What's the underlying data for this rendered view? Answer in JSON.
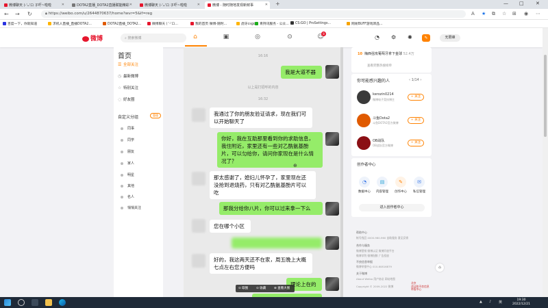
{
  "browser": {
    "tabs": [
      {
        "title": "微博聊天 (-'ᴗ'ロ 子吓~啦啦"
      },
      {
        "title": "DOTA2直播_DOTA2直播赋能精彩"
      },
      {
        "title": "微博聊天 (-'ᴗ'ロ 子吓~啦啦"
      },
      {
        "title": "微博 - 随时随地发现新鲜事"
      }
    ],
    "new_tab": "+",
    "window_controls": {
      "minimize": "—",
      "maximize": "□",
      "close": "✕"
    },
    "url": "https://weibo.com/u/2644870637/home?wvr=5&lf=reg",
    "bookmarks": [
      "百度一下，你就知道",
      "求机人直播_直播DOTA2...",
      "DOTA2直播_DOTA2...",
      "微博聊天 ( '-'ロ...",
      "我的首页 微博-随时...",
      "虎牙csgo",
      "青持讯服务 - 公众...",
      "CS:GO | ProSettings...",
      "网易BUFF游戏饰品..."
    ]
  },
  "weibo": {
    "logo": "微博",
    "search_placeholder": "搜索微博",
    "notification_count": "8",
    "user_button": "无限峰",
    "sidebar": {
      "title": "首页",
      "items": [
        {
          "label": "全部关注",
          "icon": "list-icon",
          "active": true
        },
        {
          "label": "最新微博",
          "icon": "clock-icon",
          "active": false
        },
        {
          "label": "特别关注",
          "icon": "star-icon",
          "active": false
        },
        {
          "label": "好友圈",
          "icon": "friends-icon",
          "active": false
        }
      ],
      "group_title": "自定义分组",
      "manage_label": "管理",
      "groups": [
        "同事",
        "同学",
        "朋友",
        "家人",
        "明星",
        "其他",
        "名人",
        "悄悄关注"
      ]
    },
    "chat": {
      "timestamps": [
        "16:16",
        "16:32"
      ],
      "system_notice": "以上是打招呼的内容",
      "messages": [
        {
          "from": "me",
          "text": "我是大道不器"
        },
        {
          "from": "them",
          "text": "我通过了你的朋友验证请求，现在我们可\n以开始聊天了"
        },
        {
          "from": "me",
          "text": "你好，我在互助那里看到你的求助信息，\n我住附近，家里还有一些对乙酰氨基酚\n片，可以匀给你，请问你家现在是什么情\n况了？"
        },
        {
          "from": "them",
          "text": "那太感谢了，媳妇儿怀孕了，家里现在还\n没抢到退烧药，只有对乙酰氨基酚片可以\n吃"
        },
        {
          "from": "me",
          "text": "那我分给你八片，你可以过来拿一下么"
        },
        {
          "from": "them",
          "text": "您在哪个小区"
        },
        {
          "from": "me",
          "text": ""
        },
        {
          "from": "them",
          "text": "好的，我这两天还不在家，周五晚上大概\n七点左右您方便吗"
        },
        {
          "from": "me",
          "text": "理论上在的"
        }
      ],
      "media_toolbar": [
        "⊙ 取图",
        "⊙ 收藏",
        "⊕ 查看大图"
      ]
    },
    "right": {
      "hot_rank": "10",
      "hot_title": "梅西强攻葡萄牙拿下金球",
      "hot_count": "52.4万",
      "refresh_label": "查看完整热搜榜单",
      "rec_title": "你可能感兴趣的人",
      "rec_pager": "1/14",
      "recommendations": [
        {
          "name": "kerozin0214",
          "desc": "微博电子竞技博主",
          "follow": "+ 关注"
        },
        {
          "name": "斗鱼Dota2",
          "desc": "斗鱼DOTA2官方微博",
          "follow": "+ 关注"
        },
        {
          "name": "OB战队",
          "desc": "OB战队官方微博",
          "follow": "+ 关注"
        }
      ],
      "creator_title": "创作者中心",
      "creator_tools": [
        {
          "label": "数据中心",
          "icon": "chart-icon"
        },
        {
          "label": "内容管理",
          "icon": "doc-icon"
        },
        {
          "label": "创作中心",
          "icon": "pen-icon"
        },
        {
          "label": "私信管理",
          "icon": "mail-icon"
        }
      ],
      "creator_button": "进入创作者中心",
      "footer": {
        "help_title": "帮助中心",
        "help_line": "帐号找回 4000-960-960   自助服务   意见反馈",
        "coop_title": "合作与服务",
        "coop_line1": "微博营销  微博认证  微博开放平台",
        "coop_line2": "微博学院  微博指数  广告投放",
        "report_title": "不良信息举报",
        "report_line": "微博举报中心  010-60816879",
        "about_title": "关于微博",
        "about_line": "About Weibo   用户协议   网站地图",
        "copyright": "Copyright © 2009-2022 微博",
        "badge": "北京\n违法和不良信息\n举报中心"
      }
    }
  },
  "taskbar": {
    "time": "19:30",
    "date": "2022/12/21",
    "lang": "英"
  }
}
